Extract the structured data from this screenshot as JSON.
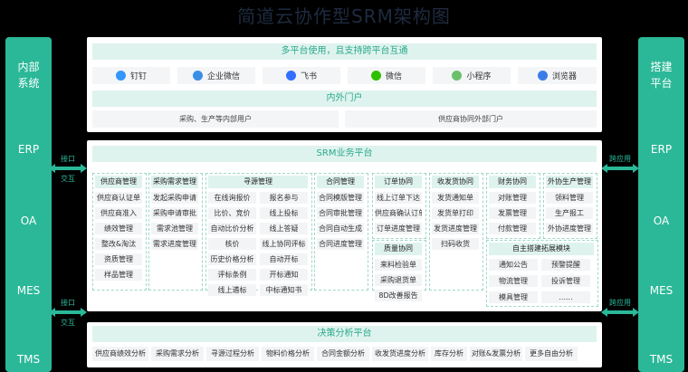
{
  "title": "简道云协作型SRM架构图",
  "left_sidebar": {
    "title_line1": "内部",
    "title_line2": "系统",
    "items": [
      "ERP",
      "OA",
      "MES",
      "TMS"
    ]
  },
  "right_sidebar": {
    "title_line1": "搭建",
    "title_line2": "平台",
    "items": [
      "ERP",
      "OA",
      "MES",
      "TMS"
    ]
  },
  "left_connectors": [
    {
      "top": "接口",
      "bottom": "交互"
    },
    {
      "top": "接口",
      "bottom": "交互"
    }
  ],
  "right_connectors": [
    {
      "top": "跨应用"
    },
    {
      "top": "跨应用"
    }
  ],
  "top_section": {
    "header": "多平台使用，且支持跨平台互通",
    "platforms": [
      {
        "label": "钉钉",
        "icon": "dingtalk-icon",
        "color": "#3296fa"
      },
      {
        "label": "企业微信",
        "icon": "wecom-icon",
        "color": "#3a8ee6"
      },
      {
        "label": "飞书",
        "icon": "feishu-icon",
        "color": "#3370ff"
      },
      {
        "label": "微信",
        "icon": "wechat-icon",
        "color": "#2dc100"
      },
      {
        "label": "小程序",
        "icon": "miniprogram-icon",
        "color": "#6bc06b"
      },
      {
        "label": "浏览器",
        "icon": "browser-icon",
        "color": "#3b7de8"
      }
    ],
    "portal_header": "内外门户",
    "portals": [
      "采购、生产等内部用户",
      "供应商协同外部门户"
    ]
  },
  "business": {
    "header": "SRM业务平台",
    "modules": [
      {
        "title": "供应商管理",
        "items": [
          "供应商认证单",
          "供应商准入",
          "绩效管理",
          "整改&淘汰",
          "资质管理",
          "样品管理"
        ]
      },
      {
        "title": "采购需求管理",
        "items": [
          "发起采购申请",
          "采购申请审批",
          "需求池管理",
          "需求进度管理"
        ]
      },
      {
        "title": "寻源管理",
        "items": [
          "在线询报价",
          "报名参与",
          "比价、竞价",
          "线上投标",
          "自动比价分析",
          "线上答疑",
          "核价",
          "线上协同评标",
          "历史价格分析",
          "自动开标",
          "评标条例",
          "开标通知",
          "线上遴标",
          "中标通知书"
        ]
      },
      {
        "title": "合同管理",
        "items": [
          "合同模版管理",
          "合同审批管理",
          "合同自动生成",
          "合同进度管理"
        ]
      },
      {
        "title": "订单协同",
        "items": [
          "线上订单下达",
          "供应商确认订单",
          "订单进度管理"
        ]
      },
      {
        "title": "质量协同",
        "items": [
          "来料检验单",
          "采购退货单",
          "8D改善报告"
        ]
      },
      {
        "title": "收发货协同",
        "items": [
          "发货通知单",
          "发货单打印",
          "发货进度管理",
          "扫码收货"
        ]
      },
      {
        "title": "财务协同",
        "items": [
          "对账管理",
          "发票管理",
          "付款管理"
        ]
      },
      {
        "title": "外协生产管理",
        "items": [
          "领料管理",
          "生产报工",
          "外协进度管理"
        ]
      },
      {
        "title": "自主搭建拓展模块",
        "items": [
          "通知公告",
          "预警提醒",
          "物流管理",
          "投诉管理",
          "模具管理",
          "......"
        ]
      }
    ]
  },
  "analysis": {
    "header": "决策分析平台",
    "items": [
      "供应商绩效分析",
      "采购需求分析",
      "寻源过程分析",
      "物料价格分析",
      "合同金额分析",
      "收发货进度分析",
      "库存分析",
      "对账&发票分析",
      "更多自由分析"
    ]
  }
}
